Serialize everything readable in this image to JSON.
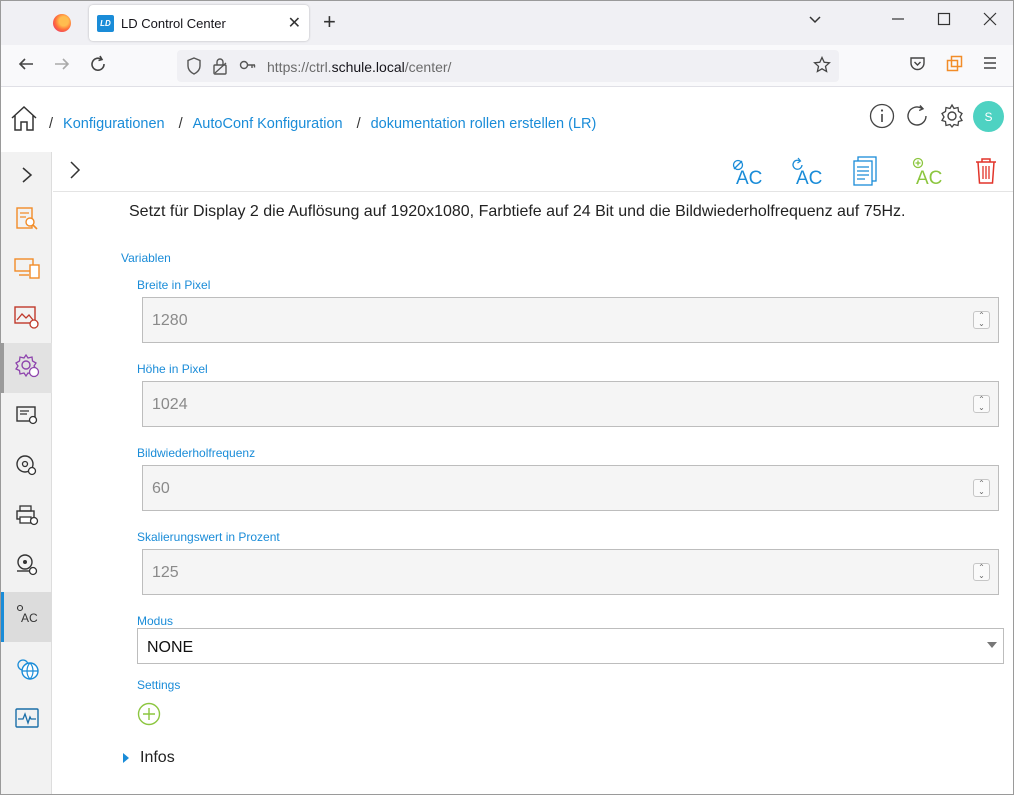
{
  "browser": {
    "tab_title": "LD Control Center",
    "tab_favicon_text": "LD",
    "url_prefix": "https://ctrl.",
    "url_domain": "schule.local",
    "url_suffix": "/center/"
  },
  "breadcrumb": [
    {
      "label": "Konfigurationen"
    },
    {
      "label": "AutoConf Konfiguration"
    },
    {
      "label": "dokumentation rollen erstellen (LR)"
    }
  ],
  "user": {
    "avatar_initial": "S"
  },
  "toolbar": {
    "icons": [
      "disable-ac-icon",
      "reset-ac-icon",
      "document-icon",
      "add-ac-icon",
      "trash-icon"
    ]
  },
  "sidebar": {
    "items": [
      "expand-chevron",
      "report-icon",
      "devices-icon",
      "image-icon",
      "settings-cog-icon",
      "server-icon",
      "disc-icon",
      "printer-icon",
      "drive-icon",
      "autoconf-icon",
      "globe-icon",
      "activity-icon"
    ]
  },
  "content": {
    "description": "Setzt für Display 2 die Auflösung auf 1920x1080, Farbtiefe auf 24 Bit und die Bildwiederholfrequenz auf 75Hz.",
    "variables_title": "Variablen",
    "fields": [
      {
        "label": "Breite in Pixel",
        "value": "1280"
      },
      {
        "label": "Höhe in Pixel",
        "value": "1024"
      },
      {
        "label": "Bildwiederholfrequenz",
        "value": "60"
      },
      {
        "label": "Skalierungswert in Prozent",
        "value": "125"
      }
    ],
    "mode_label": "Modus",
    "mode_value": "NONE",
    "settings_label": "Settings",
    "infos_label": "Infos"
  },
  "colors": {
    "accent": "#1a8cd8",
    "orange": "#f28c28",
    "green": "#8cc63f",
    "red": "#e2342a",
    "avatar": "#4ed2c2"
  }
}
